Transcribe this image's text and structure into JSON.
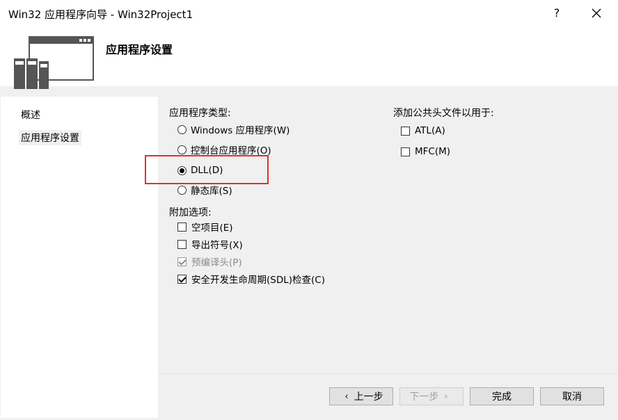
{
  "window": {
    "title": "Win32 应用程序向导 - Win32Project1",
    "help_glyph": "?",
    "close_icon": "close-icon"
  },
  "header": {
    "title": "应用程序设置",
    "icon": "server-window-icon"
  },
  "sidebar": {
    "items": [
      {
        "label": "概述",
        "active": false
      },
      {
        "label": "应用程序设置",
        "active": true
      }
    ]
  },
  "app_type": {
    "label": "应用程序类型:",
    "options": [
      {
        "label": "Windows 应用程序(W)",
        "selected": false
      },
      {
        "label": "控制台应用程序(O)",
        "selected": false
      },
      {
        "label": "DLL(D)",
        "selected": true
      },
      {
        "label": "静态库(S)",
        "selected": false
      }
    ]
  },
  "extra_options": {
    "label": "附加选项:",
    "items": [
      {
        "label": "空项目(E)",
        "checked": false,
        "enabled": true
      },
      {
        "label": "导出符号(X)",
        "checked": false,
        "enabled": true
      },
      {
        "label": "预编译头(P)",
        "checked": true,
        "enabled": false
      },
      {
        "label": "安全开发生命周期(SDL)检查(C)",
        "checked": true,
        "enabled": true
      }
    ]
  },
  "common_headers": {
    "label": "添加公共头文件以用于:",
    "items": [
      {
        "label": "ATL(A)",
        "checked": false
      },
      {
        "label": "MFC(M)",
        "checked": false
      }
    ]
  },
  "buttons": {
    "prev": "上一步",
    "next": "下一步",
    "finish": "完成",
    "cancel": "取消",
    "prev_arrow": "‹",
    "next_arrow": "›"
  },
  "colors": {
    "highlight_box": "#e03030"
  }
}
